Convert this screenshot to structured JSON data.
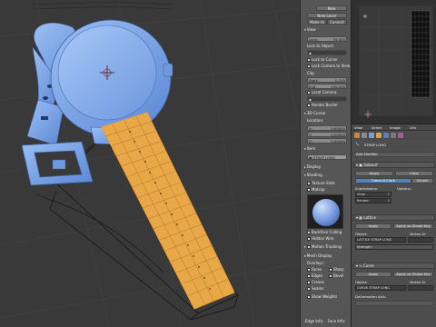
{
  "colors": {
    "accent_blue": "#5680c2",
    "mesh_blue": "#7fa6e6",
    "strap_orange": "#e8a848",
    "selection_orange": "#f0a030",
    "grid_line": "#4a4a4a"
  },
  "npanel": {
    "new_btn": "New",
    "new_layer": "New Layer",
    "make_to": "Make to",
    "convert": "Convert",
    "view_header": "View",
    "lens_label": "Lens:",
    "lens_value": "35.000",
    "lock_to_object": "Lock to Object:",
    "lock_to_cursor": "Lock to Cursor",
    "lock_camera": "Lock Camera to View",
    "clip_label": "Clip:",
    "start_label": "Start:",
    "start_value": "0.100",
    "end_label": "End:",
    "end_value": "100.000",
    "local_camera": "Local Camera:",
    "render_border": "Render Border",
    "cursor_header": "3D Cursor",
    "location_label": "Location:",
    "x_label": "X:",
    "x_value": "0.00000",
    "y_label": "Y:",
    "y_value": "0.00000",
    "z_label": "Z:",
    "z_value": "0.00000",
    "item_header": "Item",
    "item_name": "STRAP LONG",
    "display_header": "Display",
    "shading_header": "Shading",
    "texture_slots": "Texture Slots",
    "matcap": "Matcap",
    "backface_culling": "Backface Culling",
    "hidden_wire": "Hidden Wire",
    "motion_tracking": "Motion Tracking",
    "mesh_display": "Mesh Display",
    "overlays_label": "Overlays:",
    "faces": "Faces",
    "sharp": "Sharp",
    "edges": "Edges",
    "bevel": "Bevel",
    "crease": "Crease",
    "seams": "Seams",
    "show_weights": "Show Weights",
    "bottom_left": "Edge Info:",
    "bottom_right": "Face Info:"
  },
  "uv": {
    "info_a": "",
    "info_b": ""
  },
  "props": {
    "header_items": [
      "View",
      "Select",
      "Image",
      "UVs"
    ],
    "object_name": "STRAP LONG",
    "add_modifier": "Add Modifier",
    "mod1_name": "Subsurf",
    "apply": "Apply",
    "copy": "Copy",
    "catmull_clark": "Catmull-Clark",
    "simple": "Simple",
    "subdivisions": "Subdivisions:",
    "options": "Options:",
    "view_label": "View:",
    "view_value": "1",
    "render_label": "Render:",
    "render_value": "2",
    "mod2_name": "Lattice",
    "apply_as_shape": "Apply as Shape Key",
    "object_label": "Object:",
    "vertex_group": "Vertex Gr",
    "lattice_object": "LATTICE STRAP LONG",
    "strength": "Strength:",
    "mod3_name": "Curve",
    "curve_object": "CURVE STRAP LONG",
    "deformation_axis": "Deformation Axis:"
  }
}
